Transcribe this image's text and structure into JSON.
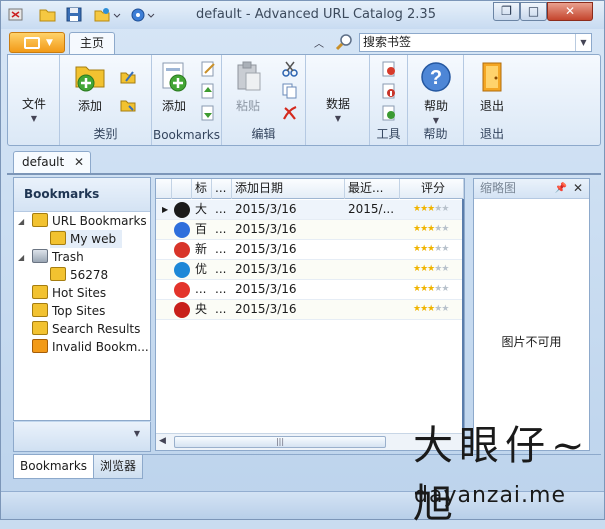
{
  "window": {
    "title": "default - Advanced URL Catalog 2.35",
    "controls": {
      "minimize": "—",
      "maximize": "□",
      "close": "✕"
    }
  },
  "quick_access": [
    "close-folder-icon",
    "open-folder-icon",
    "save-icon",
    "bookmark-dropdown-icon",
    "settings-dropdown-icon"
  ],
  "ribbon_tabs": {
    "home": "主页",
    "search_placeholder": "搜索书签"
  },
  "ribbon": {
    "file": {
      "label": "文件"
    },
    "category": {
      "add": "添加",
      "group": "类别"
    },
    "bookmarks": {
      "add": "添加",
      "group": "Bookmarks"
    },
    "edit": {
      "paste": "粘贴",
      "group": "编辑"
    },
    "data": {
      "label": "数据"
    },
    "tools": {
      "group": "工具"
    },
    "help": {
      "label": "帮助",
      "group": "帮助"
    },
    "exit": {
      "label": "退出",
      "group": "退出"
    }
  },
  "doc_tab": {
    "label": "default",
    "close": "✕"
  },
  "left_panel": {
    "header": "Bookmarks",
    "tree": [
      {
        "label": "URL Bookmarks",
        "icon": "folder-bookmarks-icon"
      },
      {
        "label": "My web",
        "icon": "folder-icon"
      },
      {
        "label": "Trash",
        "icon": "trash-icon"
      },
      {
        "label": "56278",
        "icon": "folder-icon"
      },
      {
        "label": "Hot Sites",
        "icon": "hot-folder-icon"
      },
      {
        "label": "Top Sites",
        "icon": "top-folder-icon"
      },
      {
        "label": "Search Results",
        "icon": "search-folder-icon"
      },
      {
        "label": "Invalid Bookm...",
        "icon": "invalid-folder-icon"
      }
    ]
  },
  "grid": {
    "columns": [
      "标",
      "...",
      "添加日期",
      "最近...",
      "评分"
    ],
    "rows": [
      {
        "title": "大",
        "dots": "...",
        "added": "2015/3/16",
        "recent": "2015/...",
        "rating": 3,
        "favicon": "#1a1a1a"
      },
      {
        "title": "百",
        "dots": "...",
        "added": "2015/3/16",
        "recent": "",
        "rating": 3,
        "favicon": "#2f6fdc"
      },
      {
        "title": "新",
        "dots": "...",
        "added": "2015/3/16",
        "recent": "",
        "rating": 3,
        "favicon": "#d8352a"
      },
      {
        "title": "优",
        "dots": "...",
        "added": "2015/3/16",
        "recent": "",
        "rating": 3,
        "favicon": "#1e88d8"
      },
      {
        "title": "...",
        "dots": "...",
        "added": "2015/3/16",
        "recent": "",
        "rating": 3,
        "favicon": "#e3342b"
      },
      {
        "title": "央",
        "dots": "...",
        "added": "2015/3/16",
        "recent": "",
        "rating": 3,
        "favicon": "#c8201a"
      }
    ]
  },
  "thumbnail_panel": {
    "header": "缩略图",
    "no_image": "图片不可用"
  },
  "bottom_tabs": [
    "Bookmarks",
    "浏览器"
  ],
  "watermark": {
    "logo": "大眼仔~旭",
    "url": "dayanzai.me"
  },
  "colors": {
    "accent": "#f29a18",
    "border": "#8da9cb",
    "star": "#f0b400"
  }
}
